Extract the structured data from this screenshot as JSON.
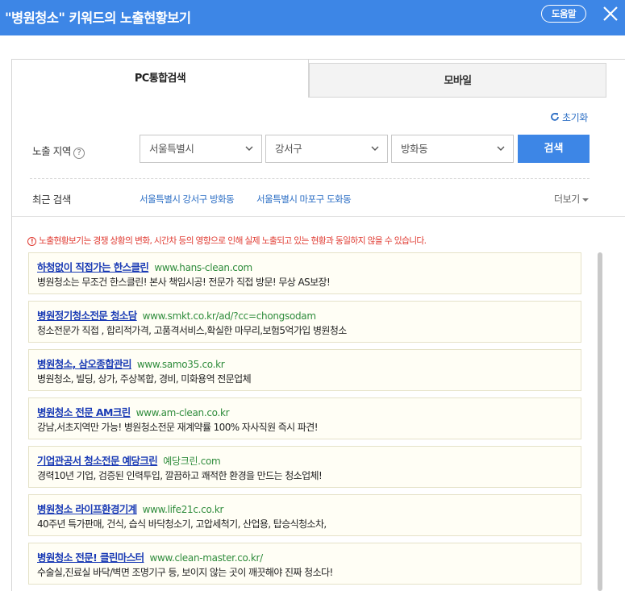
{
  "header": {
    "title": "\"병원청소\" 키워드의 노출현황보기",
    "help_label": "도움말",
    "accent_color": "#3d86e6"
  },
  "tabs": [
    {
      "label": "PC통합검색",
      "active": true
    },
    {
      "label": "모바일",
      "active": false
    }
  ],
  "reset_label": "초기화",
  "region": {
    "label": "노출 지역",
    "help_symbol": "?",
    "city": "서울특별시",
    "district": "강서구",
    "dong": "방화동",
    "search_label": "검색"
  },
  "recent": {
    "label": "최근 검색",
    "items": [
      "서울특별시 강서구 방화동",
      "서울특별시 마포구 도화동"
    ],
    "more_label": "더보기"
  },
  "notice": {
    "icon": "!",
    "text": "노출현황보기는 경쟁 상황의 변화, 시간차 등의 영향으로 인해 실제 노출되고 있는 현황과 동일하지 않을 수 있습니다."
  },
  "ads": [
    {
      "title": "하청없이 직접가는 한스클린",
      "url": "www.hans-clean.com",
      "desc": "병원청소는 무조건 한스클린! 본사 책임시공! 전문가 직접 방문! 무상 AS보장!"
    },
    {
      "title": "병원정기청소전문 청소담",
      "url": "www.smkt.co.kr/ad/?cc=chongsodam",
      "desc": "청소전문가 직접 , 합리적가격, 고품격서비스,확실한 마무리,보험5억가입 병원청소"
    },
    {
      "title": "병원청소, 삼오종합관리",
      "url": "www.samo35.co.kr",
      "desc": "병원청소, 빌딩, 상가, 주상복합, 경비, 미화용역 전문업체"
    },
    {
      "title": "병원청소 전문 AM크린",
      "url": "www.am-clean.co.kr",
      "desc": "강남,서초지역만 가능! 병원청소전문 재계약률 100% 자사직원 즉시 파견!"
    },
    {
      "title": "기업관공서 청소전문 예당크린",
      "url": "예당크린.com",
      "desc": "경력10년 기업, 검증된 인력투입, 깔끔하고 쾌적한 환경을 만드는 청소업체!"
    },
    {
      "title": "병원청소 라이프환경기계",
      "url": "www.life21c.co.kr",
      "desc": "40주년 특가판매, 건식, 습식 바닥청소기, 고압세척기, 산업용, 탑승식청소차,"
    },
    {
      "title": "병원청소 전문! 클린마스터",
      "url": "www.clean-master.co.kr/",
      "desc": "수술실,진료실 바닥/벽면 조명기구 등, 보이지 않는 곳이 깨끗해야 진짜 청소다!"
    }
  ]
}
